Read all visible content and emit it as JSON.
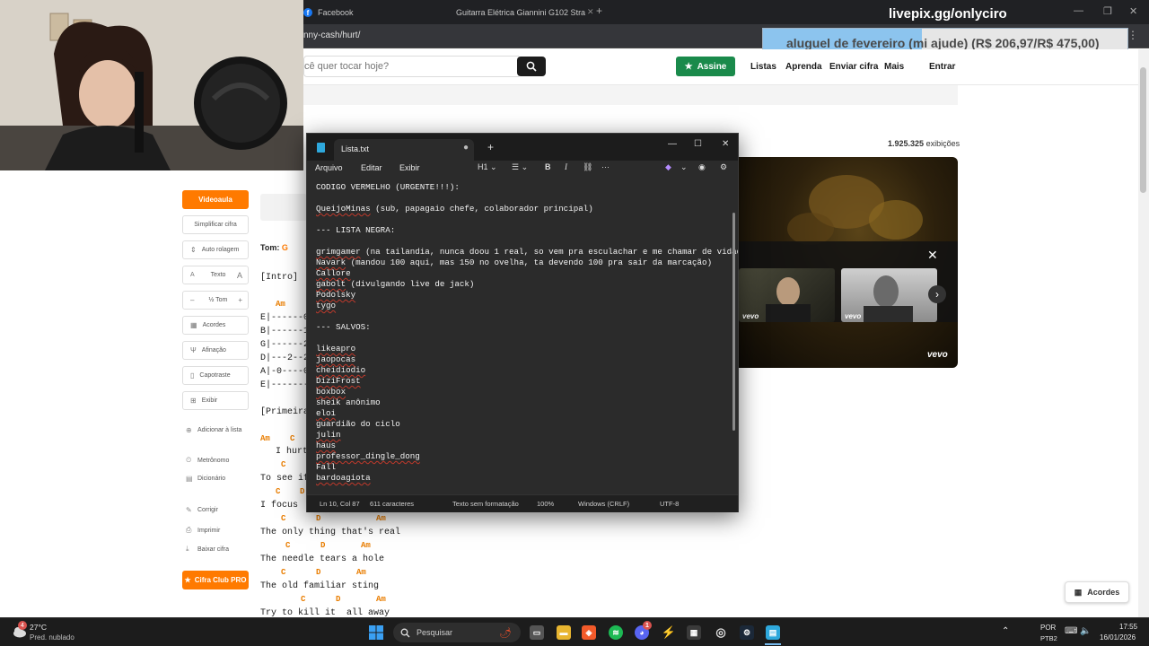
{
  "browser": {
    "tabs": [
      {
        "label": "Facebook"
      },
      {
        "label": "Guitarra Elétrica Giannini G102 Strat"
      }
    ],
    "url": "nny-cash/hurt/",
    "stream_overlay": "livepix.gg/onlyciro"
  },
  "donation_goal": {
    "text": "aluguel de fevereiro (mi ajude) (R$ 206,97/R$ 475,00)",
    "progress_percent": 43.6,
    "fill_color": "#8cc4ee"
  },
  "site": {
    "search_placeholder": "cê quer tocar hoje?",
    "assine_label": "Assine",
    "nav": [
      "Listas",
      "Aprenda",
      "Enviar cifra",
      "Mais",
      "Entrar"
    ],
    "brand_color": "#ff7a00",
    "accent_green": "#1a8a4b"
  },
  "sidebar": {
    "videoaula": "Videoaula",
    "simplificar": "Simplificar cifra",
    "auto_rolagem": "Auto rolagem",
    "texto": "Texto",
    "texto_small": "A",
    "texto_big": "A",
    "tom_minus": "–",
    "tom_label": "½ Tom",
    "tom_plus": "+",
    "links_top": [
      "Acordes",
      "Afinação",
      "Capotraste",
      "Exibir"
    ],
    "links_mid": [
      "Adicionar à lista"
    ],
    "links_bottom": [
      "Metrônomo",
      "Dicionário"
    ],
    "links_end": [
      "Corrigir",
      "Imprimir",
      "Baixar cifra"
    ],
    "pro": "Cifra Club PRO"
  },
  "song": {
    "tom_label": "Tom:",
    "tom_value": "G",
    "intro": "[Intro]",
    "tab_lines": [
      "E|------0",
      "B|------1",
      "G|------2",
      "D|---2--2",
      "A|-0----0",
      "E|-------"
    ],
    "part": "[Primeira",
    "lyrics": [
      "I hurt",
      "To see if",
      "I focus",
      "The only thing that's real",
      "The needle tears a hole",
      "The old familiar sting",
      "Try to kill it  all away"
    ],
    "chords": {
      "intro_chord": "Am",
      "am": "Am",
      "c": "C",
      "d": "D"
    }
  },
  "video": {
    "views_count": "1.925.325",
    "views_suffix": "exibições",
    "brand": "vevo"
  },
  "notepad": {
    "tab_title": "Lista.txt",
    "menus": [
      "Arquivo",
      "Editar",
      "Exibir"
    ],
    "heading_tool": "H1",
    "lines": [
      "CODIGO VERMELHO (URGENTE!!!):",
      "",
      "QueijoMinas (sub, papagaio chefe, colaborador principal)",
      "",
      "--- LISTA NEGRA:",
      "",
      "grimgamer (na tailandia, nunca doou 1 real, so vem pra esculachar e me chamar de vidad",
      "Navark (mandou 100 aqui, mas 150 no ovelha, ta devendo 100 pra sair da marcação)",
      "Callore",
      "gabolt (divulgando live de jack)",
      "Podolsky",
      "tygo",
      "",
      "--- SALVOS:",
      "",
      "likeapro",
      "jaopocas",
      "cheidiodio",
      "DiziFrost",
      "boxbox",
      "sheik anônimo",
      "eloi",
      "guardião do ciclo",
      "julin",
      "haus",
      "professor_dingle_dong",
      "Fall",
      "bardoagiota"
    ],
    "status": {
      "position": "Ln 10, Col 87",
      "chars": "611 caracteres",
      "format": "Texto sem formatação",
      "zoom": "100%",
      "eol": "Windows (CRLF)",
      "encoding": "UTF-8"
    }
  },
  "acordes_button": "Acordes",
  "taskbar": {
    "weather_temp": "27°C",
    "weather_desc": "Pred. nublado",
    "search_label": "Pesquisar",
    "lang": "POR",
    "layout": "PTB2",
    "time": "17:55",
    "date": "16/01/2026",
    "notif_badge": "4",
    "discord_badge": "1"
  }
}
